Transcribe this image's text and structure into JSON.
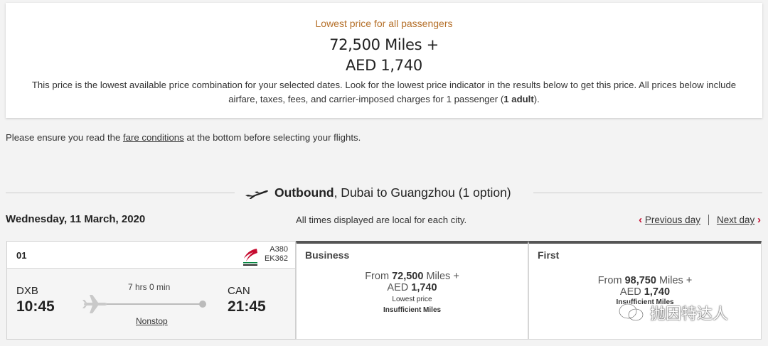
{
  "summary": {
    "heading": "Lowest price for all passengers",
    "miles": "72,500 Miles +",
    "aed": "AED 1,740",
    "note_main": "This price is the lowest available price combination for your selected dates. Look for the lowest price indicator in the results below to get this price. All prices below include airfare, taxes, fees, and carrier-imposed charges for 1 passenger (",
    "note_bold": "1 adult",
    "note_end": ")."
  },
  "ensure": {
    "before": "Please ensure you read the ",
    "link": "fare conditions",
    "after": " at the bottom before selecting your flights."
  },
  "outbound": {
    "label": "Outbound",
    "route": ", Dubai to Guangzhou (1 option)"
  },
  "date": "Wednesday, 11 March, 2020",
  "tz_note": "All times displayed are local for each city.",
  "nav": {
    "prev": "Previous day",
    "next": "Next day"
  },
  "flight": {
    "index": "01",
    "aircraft": "A380",
    "flight_no": "EK362",
    "origin_code": "DXB",
    "origin_time": "10:45",
    "dest_code": "CAN",
    "dest_time": "21:45",
    "duration": "7 hrs 0 min",
    "stops": "Nonstop"
  },
  "cabins": [
    {
      "name": "Business",
      "from": "From ",
      "miles": "72,500",
      "miles_suffix": " Miles +",
      "aed_prefix": "AED ",
      "aed": "1,740",
      "tag1": "Lowest price",
      "tag2": "Insufficient Miles"
    },
    {
      "name": "First",
      "from": "From ",
      "miles": "98,750",
      "miles_suffix": " Miles +",
      "aed_prefix": "AED ",
      "aed": "1,740",
      "tag1": "Insufficient Miles"
    }
  ],
  "watermark": "抛因特达人",
  "colors": {
    "accent": "#c60c30",
    "heading": "#b5702a",
    "cabin_bar": "#555555"
  },
  "icons": {
    "outbound": "airplane-icon",
    "airline": "emirates-logo-icon",
    "flight": "plane-icon",
    "watermark": "wechat-icon"
  }
}
